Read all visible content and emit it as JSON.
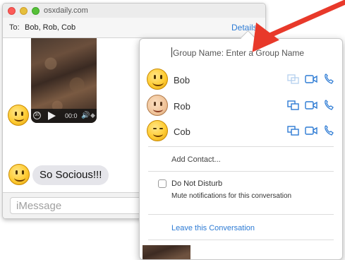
{
  "window": {
    "title": "osxdaily.com",
    "to_label": "To:",
    "to_names": "Bob, Rob, Cob",
    "details_label": "Details"
  },
  "video": {
    "replay_label": "30",
    "time": "00:0",
    "fullscreen_label": "◆"
  },
  "chat": {
    "message": "So Socious!!!"
  },
  "composer": {
    "placeholder": "iMessage"
  },
  "details": {
    "group_name": "Group Name: Enter a Group Name",
    "participants": [
      {
        "name": "Bob",
        "avatar": "smiley-emoji"
      },
      {
        "name": "Rob",
        "avatar": "light-skin-smiley-emoji"
      },
      {
        "name": "Cob",
        "avatar": "blush-smiley-emoji"
      }
    ],
    "add_contact": "Add Contact...",
    "dnd_label": "Do Not Disturb",
    "dnd_checked": false,
    "dnd_sub": "Mute notifications for this conversation",
    "leave_label": "Leave this Conversation"
  },
  "colors": {
    "accent": "#2d7bd4",
    "annotation_arrow": "#e8392a",
    "bubble": "#e5e5ea"
  }
}
